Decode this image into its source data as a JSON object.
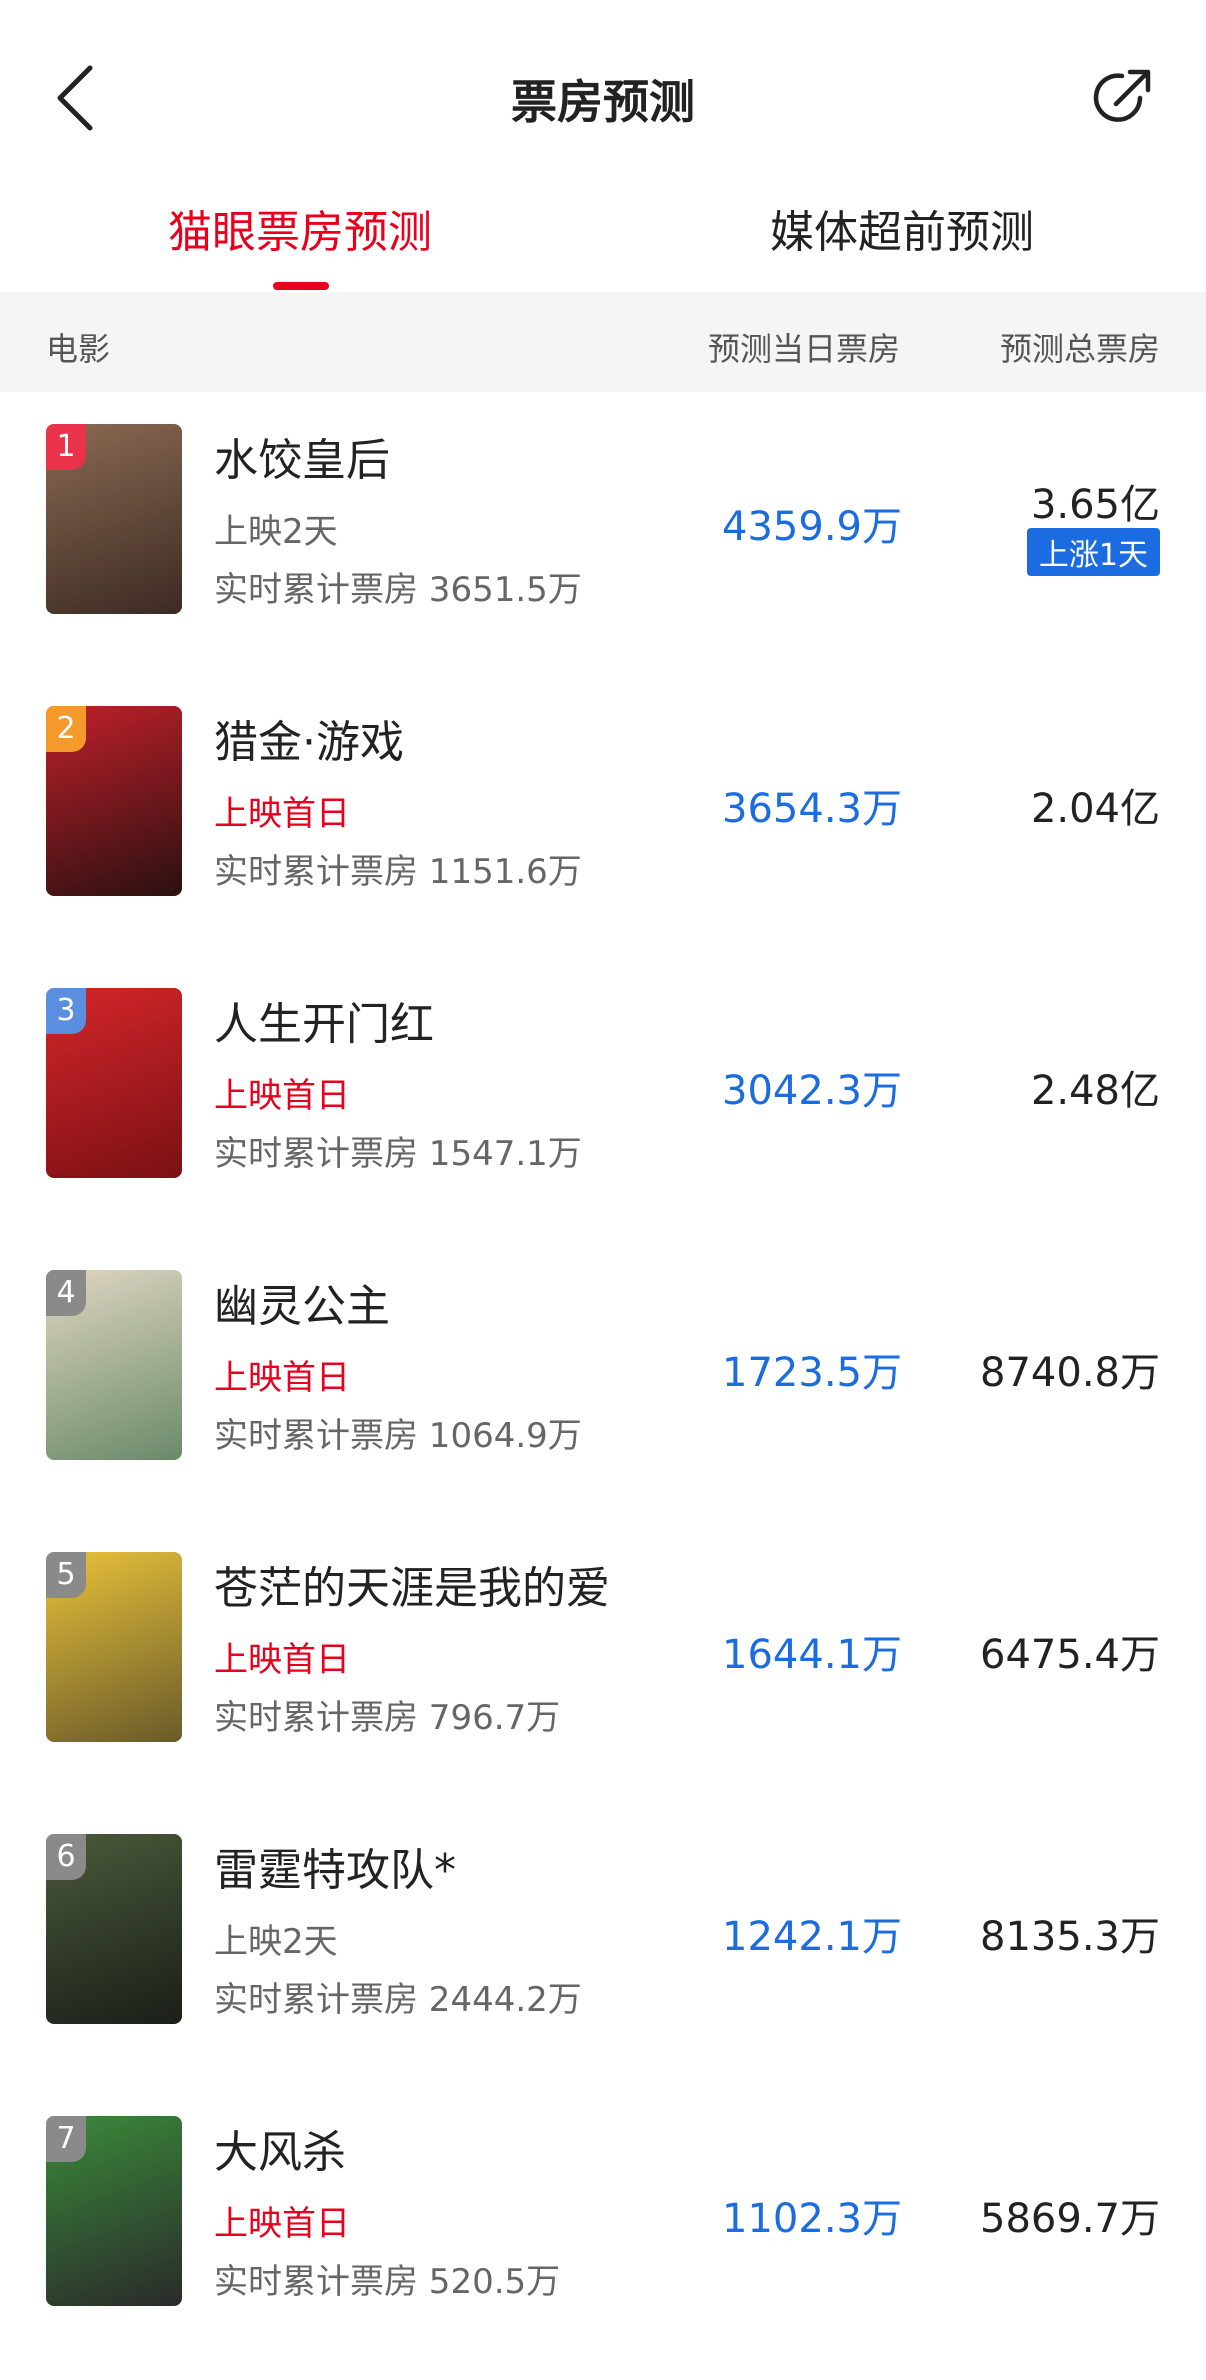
{
  "header": {
    "title": "票房预测"
  },
  "tabs": [
    {
      "label": "猫眼票房预测",
      "active": true
    },
    {
      "label": "媒体超前预测",
      "active": false
    }
  ],
  "columns": {
    "movie": "电影",
    "day": "预测当日票房",
    "total": "预测总票房"
  },
  "movies": [
    {
      "rank": "1",
      "name": "水饺皇后",
      "status": "上映2天",
      "cumulative": "实时累计票房 3651.5万",
      "day": "4359.9万",
      "total": "3.65亿",
      "badge": "上涨1天",
      "rank_color": "#e8334a",
      "poster_colors": [
        "#8a6a52",
        "#3c2a22"
      ]
    },
    {
      "rank": "2",
      "name": "猎金·游戏",
      "status": "上映首日",
      "cumulative": "实时累计票房 1151.6万",
      "day": "3654.3万",
      "total": "2.04亿",
      "rank_color": "#f39a2a",
      "poster_colors": [
        "#c0202a",
        "#2a1010"
      ]
    },
    {
      "rank": "3",
      "name": "人生开门红",
      "status": "上映首日",
      "cumulative": "实时累计票房 1547.1万",
      "day": "3042.3万",
      "total": "2.48亿",
      "rank_color": "#5a8fe0",
      "poster_colors": [
        "#d4262a",
        "#7a1014"
      ]
    },
    {
      "rank": "4",
      "name": "幽灵公主",
      "status": "上映首日",
      "cumulative": "实时累计票房 1064.9万",
      "day": "1723.5万",
      "total": "8740.8万",
      "rank_color": "#8a8a8a",
      "poster_colors": [
        "#e0d6c2",
        "#6a8a6a"
      ]
    },
    {
      "rank": "5",
      "name": "苍茫的天涯是我的爱",
      "status": "上映首日",
      "cumulative": "实时累计票房 796.7万",
      "day": "1644.1万",
      "total": "6475.4万",
      "rank_color": "#8a8a8a",
      "poster_colors": [
        "#e8c23a",
        "#6a5a2a"
      ]
    },
    {
      "rank": "6",
      "name": "雷霆特攻队*",
      "status": "上映2天",
      "cumulative": "实时累计票房 2444.2万",
      "day": "1242.1万",
      "total": "8135.3万",
      "rank_color": "#8a8a8a",
      "poster_colors": [
        "#4a5a3a",
        "#1a1e18"
      ]
    },
    {
      "rank": "7",
      "name": "大风杀",
      "status": "上映首日",
      "cumulative": "实时累计票房 520.5万",
      "day": "1102.3万",
      "total": "5869.7万",
      "rank_color": "#8a8a8a",
      "poster_colors": [
        "#3a8a3a",
        "#2a2a2a"
      ]
    }
  ]
}
